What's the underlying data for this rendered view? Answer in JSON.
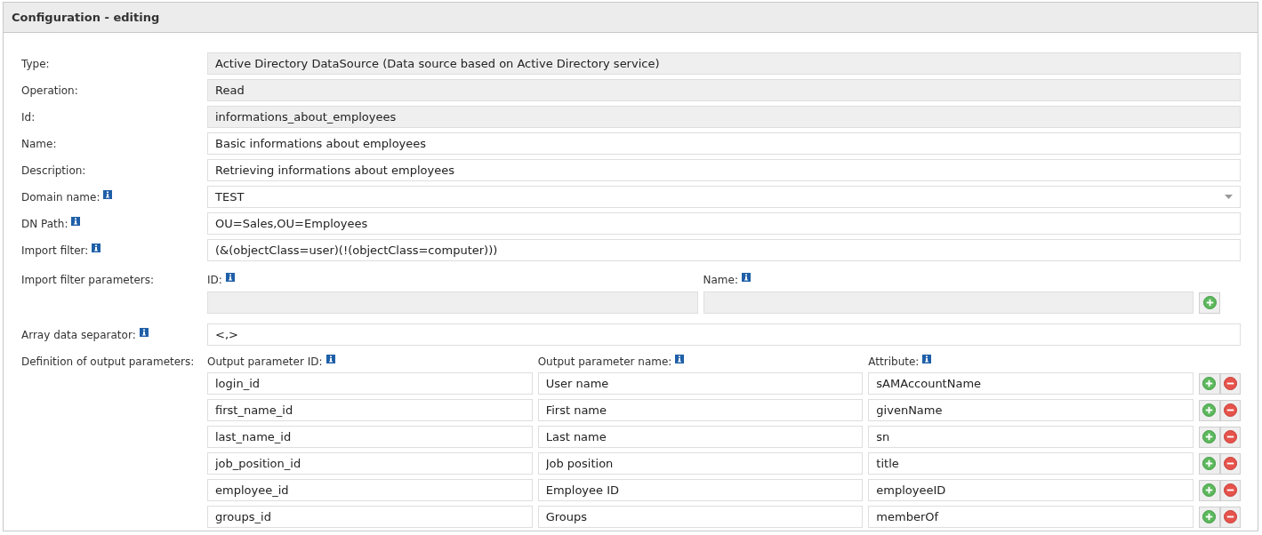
{
  "panel": {
    "title": "Configuration - editing"
  },
  "fields": [
    {
      "label": "Type:",
      "value": "Active Directory DataSource (Data source based on Active Directory service)",
      "kind": "text",
      "readonly": true,
      "info": false
    },
    {
      "label": "Operation:",
      "value": "Read",
      "kind": "text",
      "readonly": true,
      "info": false
    },
    {
      "label": "Id:",
      "value": "informations_about_employees",
      "kind": "text",
      "readonly": true,
      "info": false
    },
    {
      "label": "Name:",
      "value": "Basic informations about employees",
      "kind": "text",
      "readonly": false,
      "info": false
    },
    {
      "label": "Description:",
      "value": "Retrieving informations about employees",
      "kind": "text",
      "readonly": false,
      "info": false
    },
    {
      "label": "Domain name:",
      "value": "TEST",
      "kind": "select",
      "readonly": false,
      "info": true
    },
    {
      "label": "DN Path:",
      "value": "OU=Sales,OU=Employees",
      "kind": "text",
      "readonly": false,
      "info": true
    },
    {
      "label": "Import filter:",
      "value": "(&(objectClass=user)(!(objectClass=computer)))",
      "kind": "text",
      "readonly": false,
      "info": true
    }
  ],
  "import_filter_parameters": {
    "label": "Import filter parameters:",
    "columns": [
      {
        "label": "ID:",
        "info": true
      },
      {
        "label": "Name:",
        "info": true
      }
    ],
    "rows": [
      {
        "readonly": true,
        "cells": [
          "",
          ""
        ]
      }
    ]
  },
  "array_separator": {
    "label": "Array data separator:",
    "value": "<,>",
    "info": true
  },
  "output_parameters": {
    "label": "Definition of output parameters:",
    "columns": [
      {
        "label": "Output parameter ID:",
        "info": true
      },
      {
        "label": "Output parameter name:",
        "info": true
      },
      {
        "label": "Attribute:",
        "info": true
      }
    ],
    "rows": [
      {
        "cells": [
          "login_id",
          "User name",
          "sAMAccountName"
        ]
      },
      {
        "cells": [
          "first_name_id",
          "First name",
          "givenName"
        ]
      },
      {
        "cells": [
          "last_name_id",
          "Last name",
          "sn"
        ]
      },
      {
        "cells": [
          "job_position_id",
          "Job position",
          "title"
        ]
      },
      {
        "cells": [
          "employee_id",
          "Employee ID",
          "employeeID"
        ]
      },
      {
        "cells": [
          "groups_id",
          "Groups",
          "memberOf"
        ]
      }
    ]
  }
}
